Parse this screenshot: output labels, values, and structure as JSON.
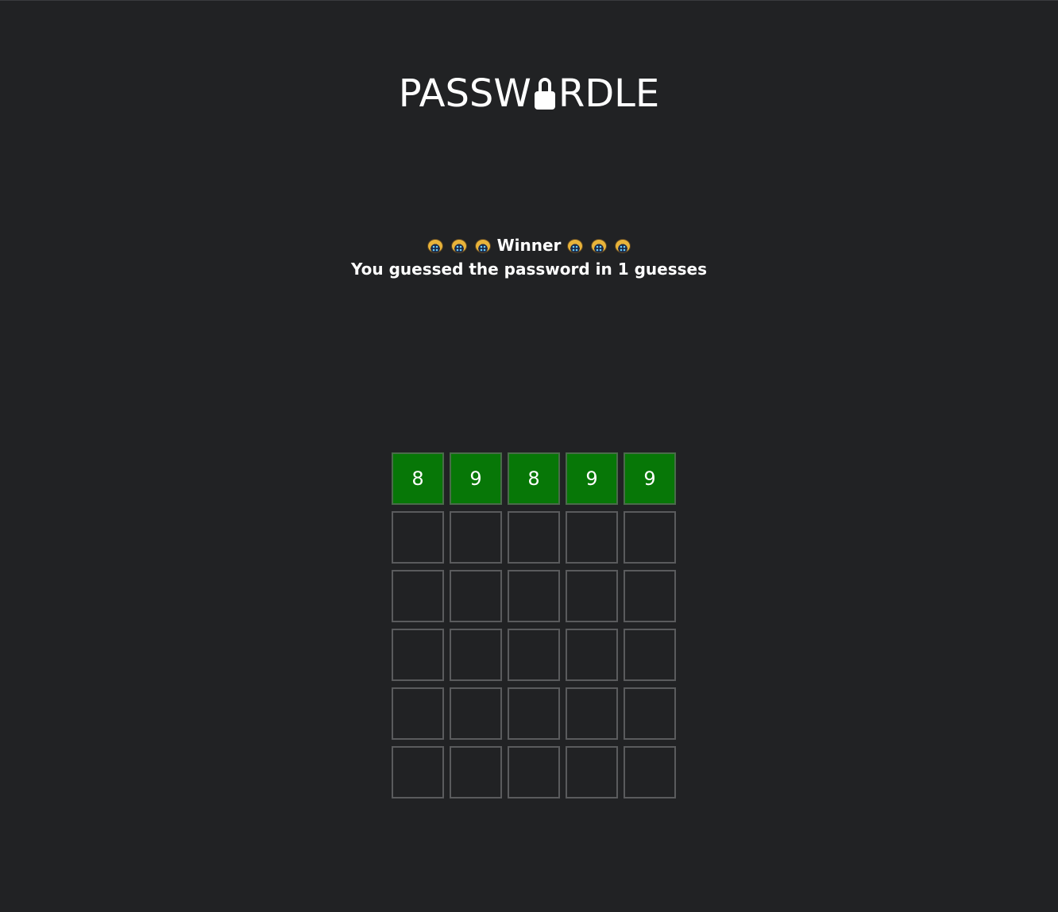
{
  "header": {
    "title_left": "PASSW",
    "title_right": "RDLE"
  },
  "status": {
    "winner_label": "Winner",
    "message": "You guessed the password in 1 guesses"
  },
  "board": {
    "rows": [
      [
        {
          "value": "8",
          "state": "correct"
        },
        {
          "value": "9",
          "state": "correct"
        },
        {
          "value": "8",
          "state": "correct"
        },
        {
          "value": "9",
          "state": "correct"
        },
        {
          "value": "9",
          "state": "correct"
        }
      ],
      [
        {
          "value": "",
          "state": "empty"
        },
        {
          "value": "",
          "state": "empty"
        },
        {
          "value": "",
          "state": "empty"
        },
        {
          "value": "",
          "state": "empty"
        },
        {
          "value": "",
          "state": "empty"
        }
      ],
      [
        {
          "value": "",
          "state": "empty"
        },
        {
          "value": "",
          "state": "empty"
        },
        {
          "value": "",
          "state": "empty"
        },
        {
          "value": "",
          "state": "empty"
        },
        {
          "value": "",
          "state": "empty"
        }
      ],
      [
        {
          "value": "",
          "state": "empty"
        },
        {
          "value": "",
          "state": "empty"
        },
        {
          "value": "",
          "state": "empty"
        },
        {
          "value": "",
          "state": "empty"
        },
        {
          "value": "",
          "state": "empty"
        }
      ],
      [
        {
          "value": "",
          "state": "empty"
        },
        {
          "value": "",
          "state": "empty"
        },
        {
          "value": "",
          "state": "empty"
        },
        {
          "value": "",
          "state": "empty"
        },
        {
          "value": "",
          "state": "empty"
        }
      ],
      [
        {
          "value": "",
          "state": "empty"
        },
        {
          "value": "",
          "state": "empty"
        },
        {
          "value": "",
          "state": "empty"
        },
        {
          "value": "",
          "state": "empty"
        },
        {
          "value": "",
          "state": "empty"
        }
      ]
    ]
  },
  "colors": {
    "background": "#212224",
    "correct": "#077707",
    "cell_border": "#5a5b5d"
  },
  "icons": {
    "title_o": "lock-icon",
    "celebration": "party-ball-icon"
  }
}
